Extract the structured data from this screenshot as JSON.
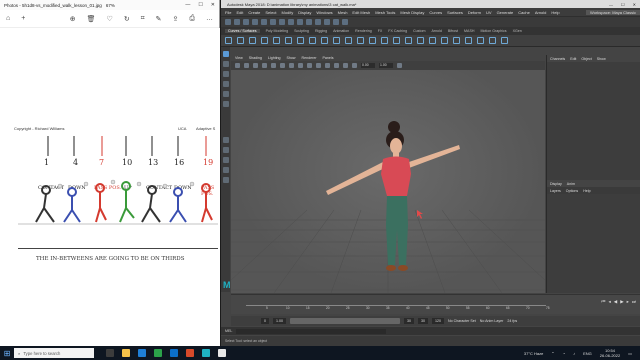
{
  "photos": {
    "title": "Photos - 5h1d8-vs_modified_walk_lesson_01.jpg",
    "zoom": "67%",
    "window_controls": [
      "—",
      "☐",
      "✕"
    ],
    "caption_left": "Copyright - Richard Williams",
    "caption_right_a": "UCA",
    "caption_right_b": "Adaptive S",
    "frame_numbers": [
      "1",
      "4",
      "7",
      "10",
      "13",
      "16",
      "19"
    ],
    "pose_labels": [
      "CONTACT",
      "DOWN",
      "PASS POS.",
      "UP",
      "CONTACT",
      "DOWN",
      "PASS POS."
    ],
    "footnote": "THE IN-BETWEENS ARE GOING TO BE ON THIRDS"
  },
  "maya": {
    "title": "Autodesk Maya 2018: D:\\animation library\\my animations\\3 cat_walk.ma*",
    "window_controls": [
      "—",
      "☐",
      "✕"
    ],
    "menus": [
      "File",
      "Edit",
      "Create",
      "Select",
      "Modify",
      "Display",
      "Windows",
      "Mesh",
      "Edit Mesh",
      "Mesh Tools",
      "Mesh Display",
      "Curves",
      "Surfaces",
      "Deform",
      "UV",
      "Generate",
      "Cache",
      "Arnold",
      "Help"
    ],
    "workspace": "Workspace: Maya Classic",
    "shelf_tabs": [
      "Curves / Surfaces",
      "Poly Modeling",
      "Sculpting",
      "Rigging",
      "Animation",
      "Rendering",
      "FX",
      "FX Caching",
      "Custom",
      "Arnold",
      "Bifrost",
      "MASH",
      "Motion Graphics",
      "XGen"
    ],
    "active_shelf": "Curves / Surfaces",
    "viewport_menus": [
      "View",
      "Shading",
      "Lighting",
      "Show",
      "Renderer",
      "Panels"
    ],
    "viewport_field_a": "0.00",
    "viewport_field_b": "1.00",
    "camera_label": "persp",
    "channel_tabs": [
      "Channels",
      "Edit",
      "Object",
      "Show"
    ],
    "layer_tabs": [
      "Display",
      "Anim"
    ],
    "layer_menu": [
      "Layers",
      "Options",
      "Help"
    ],
    "timeline_ticks": [
      "5",
      "10",
      "15",
      "20",
      "25",
      "30",
      "35",
      "40",
      "45",
      "50",
      "55",
      "60",
      "65",
      "70",
      "75"
    ],
    "range_start": "0",
    "range_inner_start": "1.00",
    "range_inner_end": "30",
    "range_end": "30",
    "range_end2": "120",
    "no_char_set": "No Character Set",
    "no_anim_layer": "No Anim Layer",
    "fps": "24 fps",
    "mel_label": "MEL",
    "help_line": "Select Tool: select an object"
  },
  "taskbar": {
    "search_placeholder": "Type here to search",
    "weather": "37°C  Haze",
    "language": "ENG",
    "time": "10:54",
    "date": "26-06-2022"
  },
  "colors": {
    "maya_accent": "#1fb2c3",
    "taskbar_bg": "#0e1621",
    "pose_red": "#d43a2f",
    "pose_green": "#3a9a3a",
    "pose_blue": "#3b4fb0"
  }
}
